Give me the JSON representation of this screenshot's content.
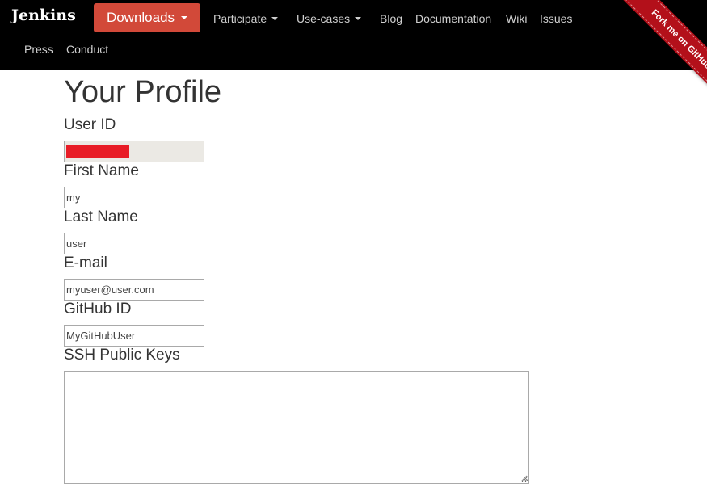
{
  "navbar": {
    "brand": "Jenkins",
    "downloads_label": "Downloads",
    "links": [
      {
        "label": "Participate",
        "has_dropdown": true
      },
      {
        "label": "Use-cases",
        "has_dropdown": true
      },
      {
        "label": "Blog",
        "has_dropdown": false
      },
      {
        "label": "Documentation",
        "has_dropdown": false
      },
      {
        "label": "Wiki",
        "has_dropdown": false
      },
      {
        "label": "Issues",
        "has_dropdown": false
      },
      {
        "label": "Press",
        "has_dropdown": false
      },
      {
        "label": "Conduct",
        "has_dropdown": false
      }
    ],
    "ribbon_text": "Fork me on GitHub"
  },
  "profile": {
    "title": "Your Profile",
    "user_id": {
      "label": "User ID",
      "value": ""
    },
    "first_name": {
      "label": "First Name",
      "value": "my"
    },
    "last_name": {
      "label": "Last Name",
      "value": "user"
    },
    "email": {
      "label": "E-mail",
      "value": "myuser@user.com"
    },
    "github_id": {
      "label": "GitHub ID",
      "value": "MyGitHubUser"
    },
    "ssh_keys": {
      "label": "SSH Public Keys",
      "value": ""
    }
  },
  "colors": {
    "navbar_bg": "#000000",
    "downloads_bg": "#d24939",
    "ribbon_bg": "#b3101a",
    "redaction": "#e81c26",
    "readonly_bg": "#ebe9e4"
  }
}
